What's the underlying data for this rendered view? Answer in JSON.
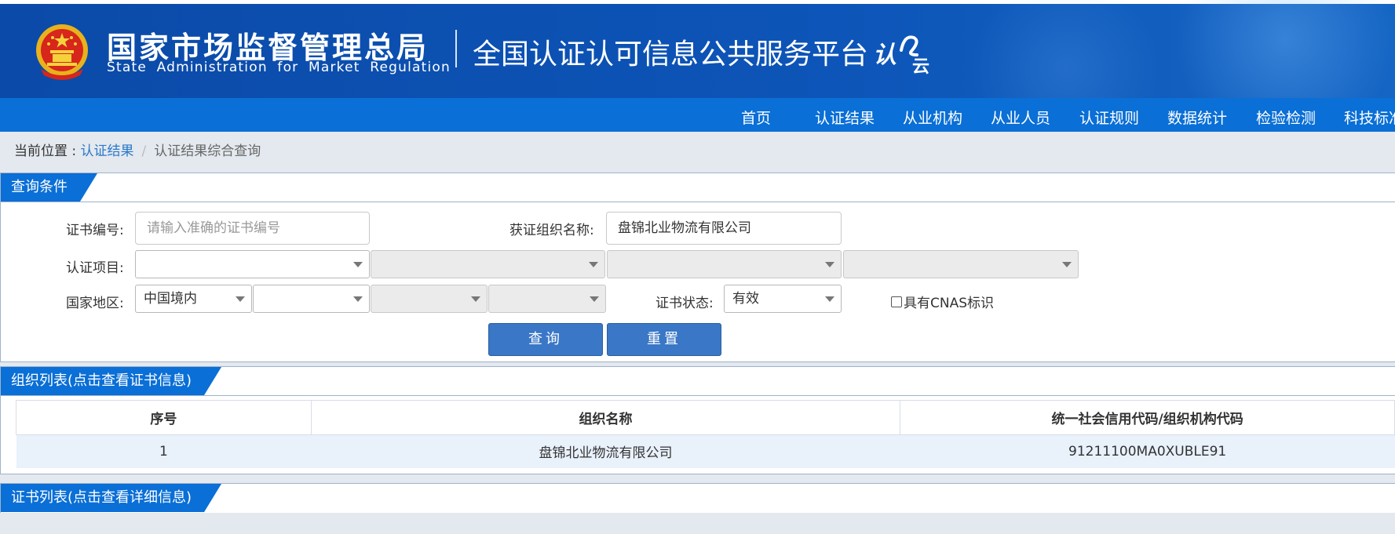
{
  "header": {
    "agency_cn": "国家市场监督管理总局",
    "agency_en": "State Administration for Market Regulation",
    "platform_title": "全国认证认可信息公共服务平台",
    "cloud_logo_text": "认云"
  },
  "nav": {
    "items": [
      "首页",
      "认证结果",
      "从业机构",
      "从业人员",
      "认证规则",
      "数据统计",
      "检验检测",
      "科技标准"
    ]
  },
  "breadcrumb": {
    "prefix": "当前位置 : ",
    "link": "认证结果",
    "separator": "/",
    "current": "认证结果综合查询"
  },
  "query": {
    "tab_label": "查询条件",
    "cert_no_label": "证书编号:",
    "cert_no_placeholder": "请输入准确的证书编号",
    "cert_no_value": "",
    "org_name_label": "获证组织名称:",
    "org_name_value": "盘锦北业物流有限公司",
    "project_label": "认证项目:",
    "project_selects": [
      "",
      "",
      "",
      ""
    ],
    "region_label": "国家地区:",
    "region_selects": [
      "中国境内",
      "",
      "",
      ""
    ],
    "status_label": "证书状态:",
    "status_value": "有效",
    "cnas_label": "具有CNAS标识",
    "search_button": "查询",
    "reset_button": "重置"
  },
  "org_list": {
    "tab_label": "组织列表(点击查看证书信息)",
    "columns": [
      "序号",
      "组织名称",
      "统一社会信用代码/组织机构代码"
    ],
    "rows": [
      {
        "index": "1",
        "name": "盘锦北业物流有限公司",
        "code": "91211100MA0XUBLE91"
      }
    ]
  },
  "cert_list": {
    "tab_label": "证书列表(点击查看详细信息)"
  },
  "colors": {
    "header_blue": "#0b4aa8",
    "nav_blue": "#0a6fd6",
    "button_blue": "#3a77c6",
    "link_blue": "#2a78c9",
    "row_highlight": "#e9f1fb"
  }
}
